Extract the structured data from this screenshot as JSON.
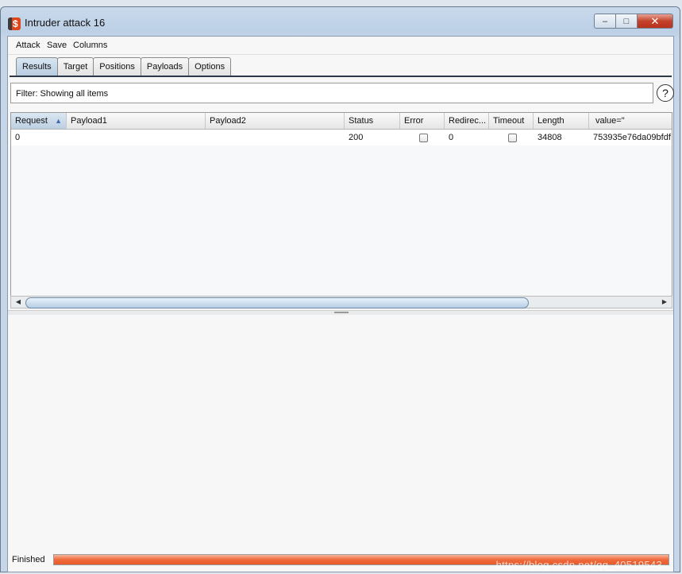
{
  "window": {
    "title": "Intruder attack 16",
    "icon": "burp-suite-icon",
    "buttons": {
      "min": "–",
      "max": "□",
      "close": "✕"
    }
  },
  "menu": [
    "Attack",
    "Save",
    "Columns"
  ],
  "tabs": [
    "Results",
    "Target",
    "Positions",
    "Payloads",
    "Options"
  ],
  "active_tab": "Results",
  "filter": {
    "label": "Filter: Showing all items",
    "help": "?"
  },
  "table": {
    "columns": [
      "Request",
      "Payload1",
      "Payload2",
      "Status",
      "Error",
      "Redirec...",
      "Timeout",
      "Length",
      "value=\""
    ],
    "sorted_column": "Request",
    "sort_direction": "ascending",
    "rows": [
      {
        "request": "0",
        "payload1": "",
        "payload2": "",
        "status": "200",
        "error": false,
        "redirects": "0",
        "timeout": false,
        "length": "34808",
        "value": "753935e76da09bfdf"
      }
    ]
  },
  "status": {
    "text": "Finished",
    "progress": 1.0,
    "progress_color": "#ef6a3b"
  },
  "watermark": "https://blog.csdn.net/qq_40519543"
}
